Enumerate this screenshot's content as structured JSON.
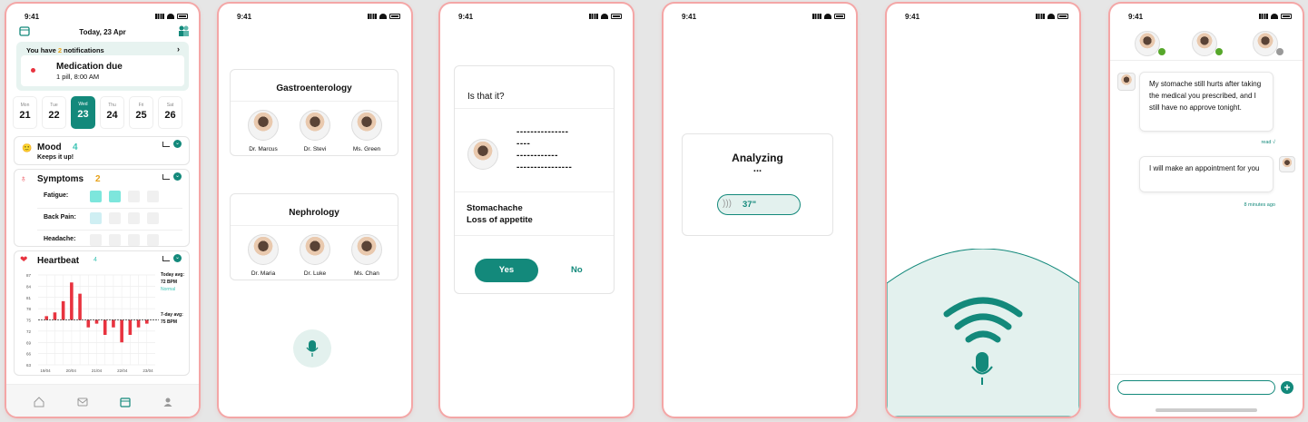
{
  "status_time": "9:41",
  "home": {
    "date": "Today, 23 Apr",
    "notif_prefix": "You have ",
    "notif_count": "2",
    "notif_suffix": " notifications",
    "med_title": "Medication due",
    "med_sub": "1 pill, 8:00 AM",
    "days": [
      {
        "d": "Mon",
        "n": "21"
      },
      {
        "d": "Tue",
        "n": "22"
      },
      {
        "d": "Wed",
        "n": "23"
      },
      {
        "d": "Thu",
        "n": "24"
      },
      {
        "d": "Fri",
        "n": "25"
      },
      {
        "d": "Sat",
        "n": "26"
      }
    ],
    "mood_label": "Mood",
    "mood_value": "4",
    "mood_note": "Keeps it up!",
    "symptoms_label": "Symptoms",
    "symptoms_count": "2",
    "symptoms": [
      {
        "name": "Fatigue:",
        "levels": [
          1,
          1,
          0,
          0
        ]
      },
      {
        "name": "Back Pain:",
        "levels": [
          2,
          0,
          0,
          0
        ]
      },
      {
        "name": "Headache:",
        "levels": [
          0,
          0,
          0,
          0
        ]
      }
    ],
    "heartbeat_label": "Heartbeat",
    "heartbeat_count": "4",
    "today_avg_label": "Today avg:",
    "today_avg_value": "72 BPM",
    "today_avg_status": "Normal",
    "week_avg_label": "7-day avg:",
    "week_avg_value": "75 BPM"
  },
  "chart_data": {
    "type": "bar",
    "baseline": 75,
    "ylim": [
      63,
      87
    ],
    "yticks": [
      "87",
      "84",
      "81",
      "78",
      "75",
      "72",
      "69",
      "66",
      "63"
    ],
    "xticks": [
      "19/04",
      "20/04",
      "21/04",
      "22/04",
      "23/04"
    ],
    "values": [
      76,
      77,
      80,
      85,
      82,
      73,
      74,
      71,
      73,
      69,
      71,
      73,
      74
    ]
  },
  "specialties": {
    "groups": [
      {
        "title": "Gastroenterology",
        "doctors": [
          "Dr. Marcus",
          "Dr. Stevi",
          "Ms. Green"
        ]
      },
      {
        "title": "Nephrology",
        "doctors": [
          "Dr. Maria",
          "Dr. Luke",
          "Ms. Chan"
        ]
      }
    ]
  },
  "confirm": {
    "question": "Is that it?",
    "dash_lines": [
      "---------------",
      "----",
      "------------",
      "----------------"
    ],
    "symptoms_text": [
      "Stomachache",
      "Loss of appetite"
    ],
    "yes": "Yes",
    "no": "No"
  },
  "analyzing": {
    "title": "Analyzing",
    "dots": "...",
    "duration": "37\""
  },
  "chat": {
    "msg1": "My stomache still hurts after taking the medical you prescribed, and I still have no approve tonight.",
    "read": "read √",
    "msg2": "I will make an appointment for you",
    "time2": "8 minutes ago"
  },
  "colors": {
    "accent": "#13897b",
    "bar": "#e8333f",
    "light_teal": "#e3f1ee"
  }
}
